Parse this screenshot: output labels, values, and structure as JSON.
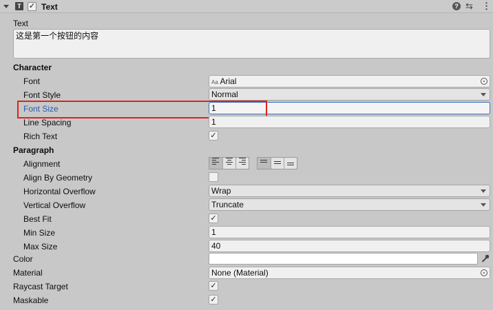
{
  "component": {
    "title": "Text",
    "type_icon": "text-component-icon",
    "enabled_check": "✓",
    "help_icon": "?",
    "presets_icon": "⇆",
    "menu_icon": "⋮"
  },
  "text_label": "Text",
  "text_value": "这是第一个按钮的内容",
  "character": {
    "header": "Character",
    "font_label": "Font",
    "font_icon_text": "Aa",
    "font_value": "Arial",
    "font_style_label": "Font Style",
    "font_style_value": "Normal",
    "font_size_label": "Font Size",
    "font_size_value": "1",
    "line_spacing_label": "Line Spacing",
    "line_spacing_value": "1",
    "rich_text_label": "Rich Text",
    "rich_text_check": "✓"
  },
  "paragraph": {
    "header": "Paragraph",
    "alignment_label": "Alignment",
    "align_by_geometry_label": "Align By Geometry",
    "horizontal_overflow_label": "Horizontal Overflow",
    "horizontal_overflow_value": "Wrap",
    "vertical_overflow_label": "Vertical Overflow",
    "vertical_overflow_value": "Truncate",
    "best_fit_label": "Best Fit",
    "best_fit_check": "✓",
    "min_size_label": "Min Size",
    "min_size_value": "1",
    "max_size_label": "Max Size",
    "max_size_value": "40"
  },
  "color_label": "Color",
  "material_label": "Material",
  "material_value": "None (Material)",
  "raycast_label": "Raycast Target",
  "raycast_check": "✓",
  "maskable_label": "Maskable",
  "maskable_check": "✓",
  "colors": {
    "highlight_box": "#e02020",
    "focused_label": "#2c5aa8",
    "focused_border": "#3a72c4",
    "color_swatch": "#ffffff"
  }
}
